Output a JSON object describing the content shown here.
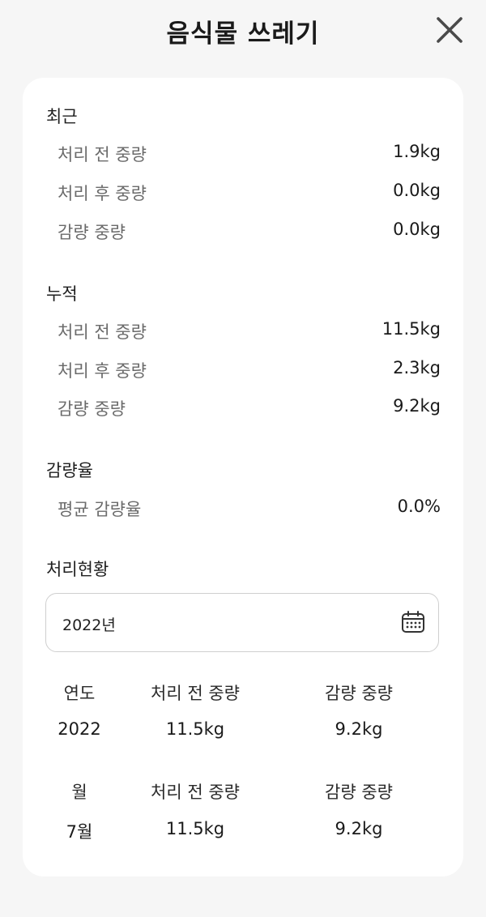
{
  "header": {
    "title": "음식물 쓰레기",
    "close_icon": "close-icon"
  },
  "recent": {
    "title": "최근",
    "rows": [
      {
        "label": "처리 전 중량",
        "value": "1.9kg"
      },
      {
        "label": "처리 후 중량",
        "value": "0.0kg"
      },
      {
        "label": "감량 중량",
        "value": "0.0kg"
      }
    ]
  },
  "cumulative": {
    "title": "누적",
    "rows": [
      {
        "label": "처리 전 중량",
        "value": "11.5kg"
      },
      {
        "label": "처리 후 중량",
        "value": "2.3kg"
      },
      {
        "label": "감량 중량",
        "value": "9.2kg"
      }
    ]
  },
  "reduction_rate": {
    "title": "감량율",
    "rows": [
      {
        "label": "평균 감량율",
        "value": "0.0%"
      }
    ]
  },
  "status": {
    "title": "처리현황",
    "date_value": "2022년",
    "calendar_icon": "calendar-icon",
    "yearly": {
      "headers": [
        "연도",
        "처리 전 중량",
        "감량 중량"
      ],
      "values": [
        "2022",
        "11.5kg",
        "9.2kg"
      ]
    },
    "monthly": {
      "headers": [
        "월",
        "처리 전 중량",
        "감량 중량"
      ],
      "values": [
        "7월",
        "11.5kg",
        "9.2kg"
      ]
    }
  },
  "colors": {
    "background": "#f6f6f6",
    "card": "#ffffff",
    "label_gray": "#6b6b6b",
    "text": "#1a1a1a"
  }
}
